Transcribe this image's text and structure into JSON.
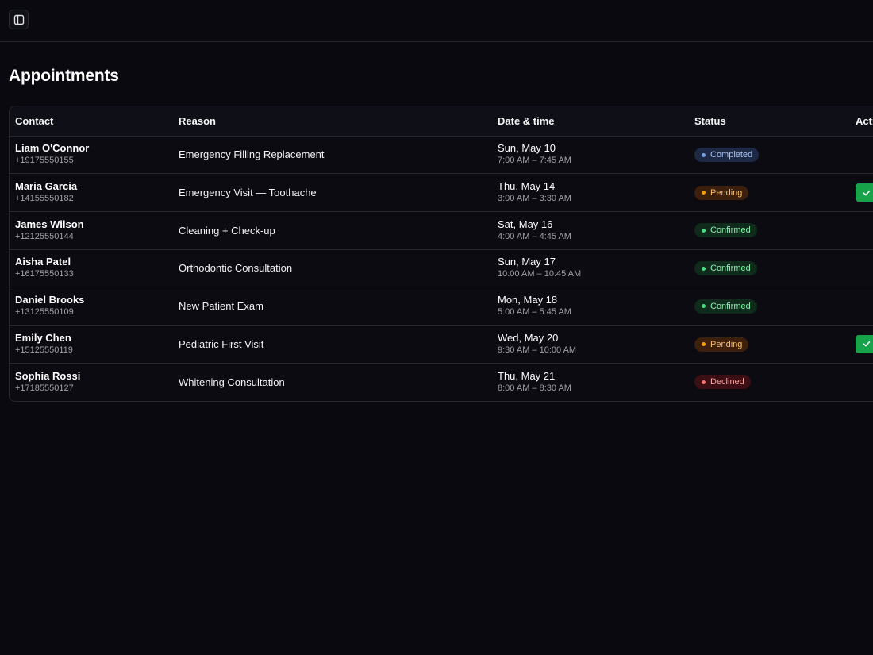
{
  "page": {
    "title": "Appointments"
  },
  "icons": {
    "sidebar_toggle": "sidebar-toggle-icon",
    "approve": "check-icon"
  },
  "colors": {
    "background": "#09090f",
    "completed": "#7aa2e8",
    "pending": "#f59e0b",
    "confirmed": "#4ade80",
    "declined": "#f87171",
    "approve_button": "#16a34a"
  },
  "table": {
    "columns": [
      "Contact",
      "Reason",
      "Date & time",
      "Status",
      "Actions"
    ],
    "rows": [
      {
        "name": "Liam O'Connor",
        "phone": "+19175550155",
        "reason": "Emergency Filling Replacement",
        "date": "Sun, May 10",
        "time": "7:00 AM – 7:45 AM",
        "status": "Completed",
        "status_key": "completed",
        "has_action": false
      },
      {
        "name": "Maria Garcia",
        "phone": "+14155550182",
        "reason": "Emergency Visit — Toothache",
        "date": "Thu, May 14",
        "time": "3:00 AM – 3:30 AM",
        "status": "Pending",
        "status_key": "pending",
        "has_action": true
      },
      {
        "name": "James Wilson",
        "phone": "+12125550144",
        "reason": "Cleaning + Check-up",
        "date": "Sat, May 16",
        "time": "4:00 AM – 4:45 AM",
        "status": "Confirmed",
        "status_key": "confirmed",
        "has_action": false
      },
      {
        "name": "Aisha Patel",
        "phone": "+16175550133",
        "reason": "Orthodontic Consultation",
        "date": "Sun, May 17",
        "time": "10:00 AM – 10:45 AM",
        "status": "Confirmed",
        "status_key": "confirmed",
        "has_action": false
      },
      {
        "name": "Daniel Brooks",
        "phone": "+13125550109",
        "reason": "New Patient Exam",
        "date": "Mon, May 18",
        "time": "5:00 AM – 5:45 AM",
        "status": "Confirmed",
        "status_key": "confirmed",
        "has_action": false
      },
      {
        "name": "Emily Chen",
        "phone": "+15125550119",
        "reason": "Pediatric First Visit",
        "date": "Wed, May 20",
        "time": "9:30 AM – 10:00 AM",
        "status": "Pending",
        "status_key": "pending",
        "has_action": true
      },
      {
        "name": "Sophia Rossi",
        "phone": "+17185550127",
        "reason": "Whitening Consultation",
        "date": "Thu, May 21",
        "time": "8:00 AM – 8:30 AM",
        "status": "Declined",
        "status_key": "declined",
        "has_action": false
      }
    ]
  }
}
